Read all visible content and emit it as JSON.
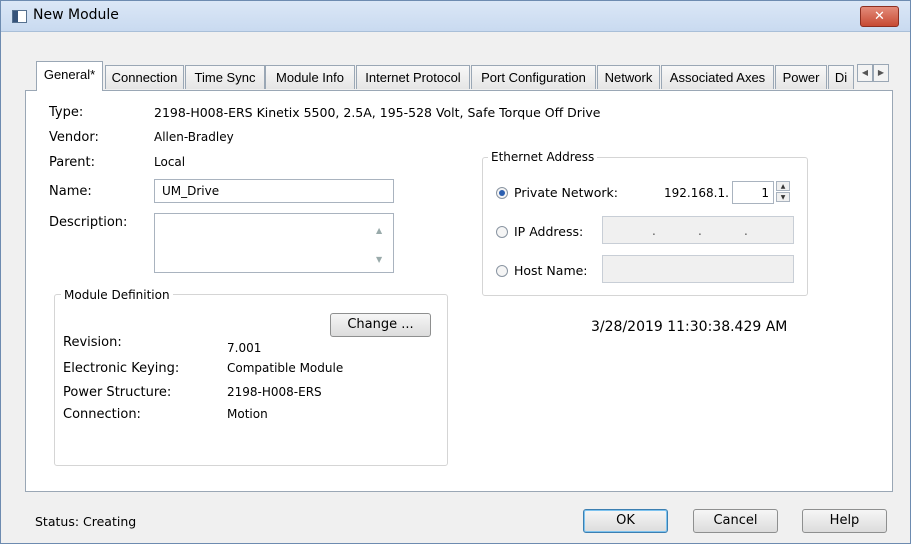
{
  "window": {
    "title": "New Module",
    "close_label": "✕"
  },
  "tabs": [
    {
      "label": "General*",
      "active": true
    },
    {
      "label": "Connection"
    },
    {
      "label": "Time Sync"
    },
    {
      "label": "Module Info"
    },
    {
      "label": "Internet Protocol"
    },
    {
      "label": "Port Configuration"
    },
    {
      "label": "Network"
    },
    {
      "label": "Associated Axes"
    },
    {
      "label": "Power"
    },
    {
      "label": "Di"
    }
  ],
  "general": {
    "type_label": "Type:",
    "type_value": "2198-H008-ERS Kinetix 5500, 2.5A, 195-528 Volt, Safe Torque Off Drive",
    "vendor_label": "Vendor:",
    "vendor_value": "Allen-Bradley",
    "parent_label": "Parent:",
    "parent_value": "Local",
    "name_label": "Name:",
    "name_value": "UM_Drive",
    "description_label": "Description:",
    "description_value": ""
  },
  "module_definition": {
    "title": "Module Definition",
    "change_button": "Change ...",
    "revision_label": "Revision:",
    "revision_value": "7.001",
    "keying_label": "Electronic Keying:",
    "keying_value": "Compatible Module",
    "power_label": "Power Structure:",
    "power_value": "2198-H008-ERS",
    "connection_label": "Connection:",
    "connection_value": "Motion"
  },
  "ethernet": {
    "title": "Ethernet Address",
    "private_label": "Private Network:",
    "private_prefix": "192.168.1.",
    "private_last_octet": "1",
    "ip_label": "IP Address:",
    "host_label": "Host Name:",
    "selected": "Private Network"
  },
  "timestamp": "3/28/2019 11:30:38.429 AM",
  "footer": {
    "status": "Status:  Creating",
    "ok": "OK",
    "cancel": "Cancel",
    "help": "Help"
  }
}
